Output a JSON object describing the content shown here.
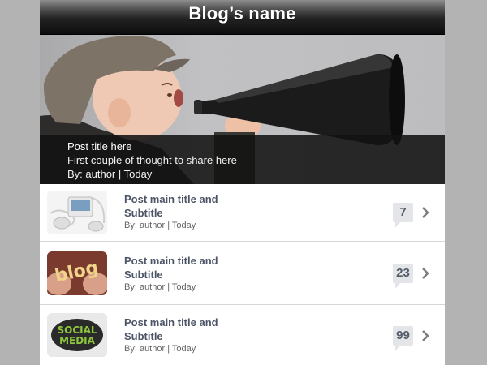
{
  "header": {
    "title": "Blog’s name"
  },
  "featured": {
    "title": "Post title here",
    "excerpt": "First couple of thought to share here",
    "byline": "By: author | Today"
  },
  "posts": [
    {
      "title": "Post main title and Subtitle",
      "byline": "By: author | Today",
      "comments": "7",
      "thumb_icon": "ipod-icon"
    },
    {
      "title": "Post main title and Subtitle",
      "byline": "By: author | Today",
      "comments": "23",
      "thumb_icon": "blog-hands-icon"
    },
    {
      "title": "Post main title and Subtitle",
      "byline": "By: author | Today",
      "comments": "99",
      "thumb_icon": "social-media-icon"
    }
  ],
  "thumb_text": {
    "blog": "blog",
    "social": "SOCIAL",
    "media": "MEDIA"
  },
  "colors": {
    "background": "#b3b3b3",
    "title_text": "#4c5566",
    "badge": "#e3e5e8"
  }
}
